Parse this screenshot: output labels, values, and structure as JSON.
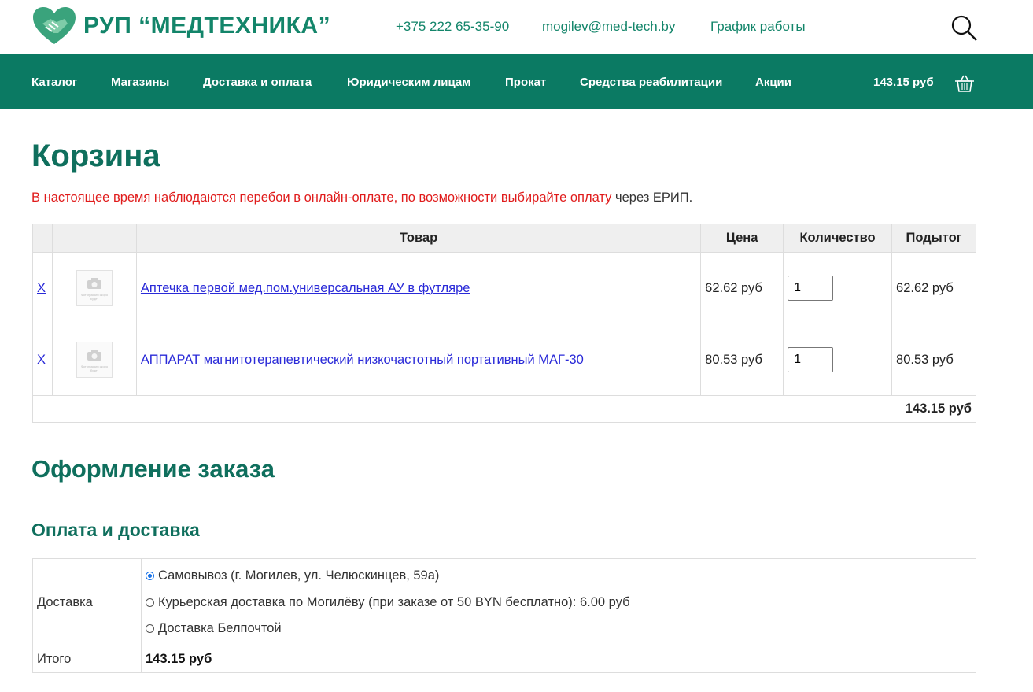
{
  "brand": {
    "name": "РУП “МЕДТЕХНИКА”",
    "color": "#13856a"
  },
  "header": {
    "phone": "+375 222 65-35-90",
    "email": "mogilev@med-tech.by",
    "schedule": "График работы"
  },
  "nav": {
    "items": [
      "Каталог",
      "Магазины",
      "Доставка и оплата",
      "Юридическим лицам",
      "Прокат",
      "Средства реабилитации",
      "Акции"
    ],
    "cart_total": "143.15 руб",
    "bg_color": "#0b7a63"
  },
  "cart": {
    "title": "Корзина",
    "notice": "В настоящее время наблюдаются перебои в онлайн-оплате, по возможности выбирайте оплату",
    "notice_tail": " через ЕРИП.",
    "columns": [
      "",
      "",
      "Товар",
      "Цена",
      "Количество",
      "Подытог"
    ],
    "rows": [
      {
        "remove": "X",
        "image_text": "Фотография скоро будет",
        "name": "Аптечка первой мед.пом.универсальная АУ в футляре",
        "price": "62.62 руб",
        "qty": "1",
        "subtotal": "62.62 руб"
      },
      {
        "remove": "X",
        "image_text": "Фотография скоро будет",
        "name": "АППАРАТ магнитотерапевтический низкочастотный портативный МАГ-30",
        "price": "80.53 руб",
        "qty": "1",
        "subtotal": "80.53 руб"
      }
    ],
    "total": "143.15 руб"
  },
  "checkout": {
    "title": "Оформление заказа",
    "payment_title": "Оплата и доставка",
    "delivery_label": "Доставка",
    "options": [
      {
        "label": "Самовывоз (г. Могилев, ул. Челюскинцев, 59а)",
        "selected": true
      },
      {
        "label": "Курьерская доставка по Могилёву (при заказе от 50 BYN бесплатно): 6.00 руб",
        "selected": false
      },
      {
        "label": "Доставка Белпочтой",
        "selected": false
      }
    ],
    "total_label": "Итого",
    "total_value": "143.15 руб"
  }
}
